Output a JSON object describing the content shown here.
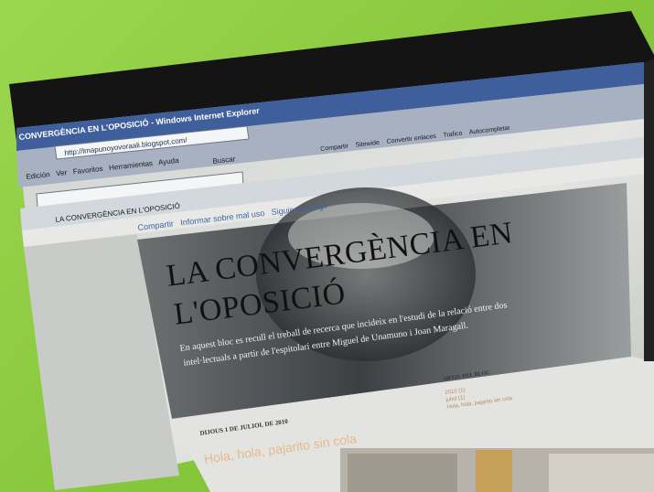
{
  "colors": {
    "page_background": "#8fce45",
    "monitor_bezel": "#141414",
    "ie_chrome": "#9aa6b8",
    "blog_background": "#d9dbd8",
    "header_image": "#4e5254",
    "post_title_color": "#e6b98a"
  },
  "browser": {
    "window_title": "CONVERGÈNCIA EN L'OPOSICIÓ - Windows Internet Explorer",
    "address": "http://lmapunoyovoraali.blogspot.com/",
    "menu": [
      "Edición",
      "Ver",
      "Favoritos",
      "Herramientas",
      "Ayuda"
    ],
    "search_label": "Buscar",
    "toolbar_items": [
      "Compartir",
      "Sitewide",
      "Convertir enlaces",
      "Trafico",
      "Autocompletar"
    ],
    "tab_title": "LA CONVERGÈNCIA EN L'OPOSICIÓ"
  },
  "blogger_navbar": {
    "links": [
      "Compartir",
      "Informar sobre mal uso",
      "Siguiente blog»"
    ]
  },
  "blog": {
    "title_line1": "LA CONVERGÈNCIA EN",
    "title_line2": "L'OPOSICIÓ",
    "description_line1": "En aquest bloc es recull el treball de recerca que incideix en l'estudi de la relació entre dos",
    "description_line2": "intel·lectuals a partir de l'espitolari entre Miguel de Unamuno i Joan Maragall.",
    "post_date": "DIJOUS 1 DE JULIOL DE 2010",
    "post_title": "Hola, hola, pajarito sin cola",
    "archive_heading": "ARXIU DEL BLOC",
    "archive_items": [
      "2010 (1)",
      "juliol (1)",
      "Hola, hola, pajarito sin cola"
    ]
  }
}
